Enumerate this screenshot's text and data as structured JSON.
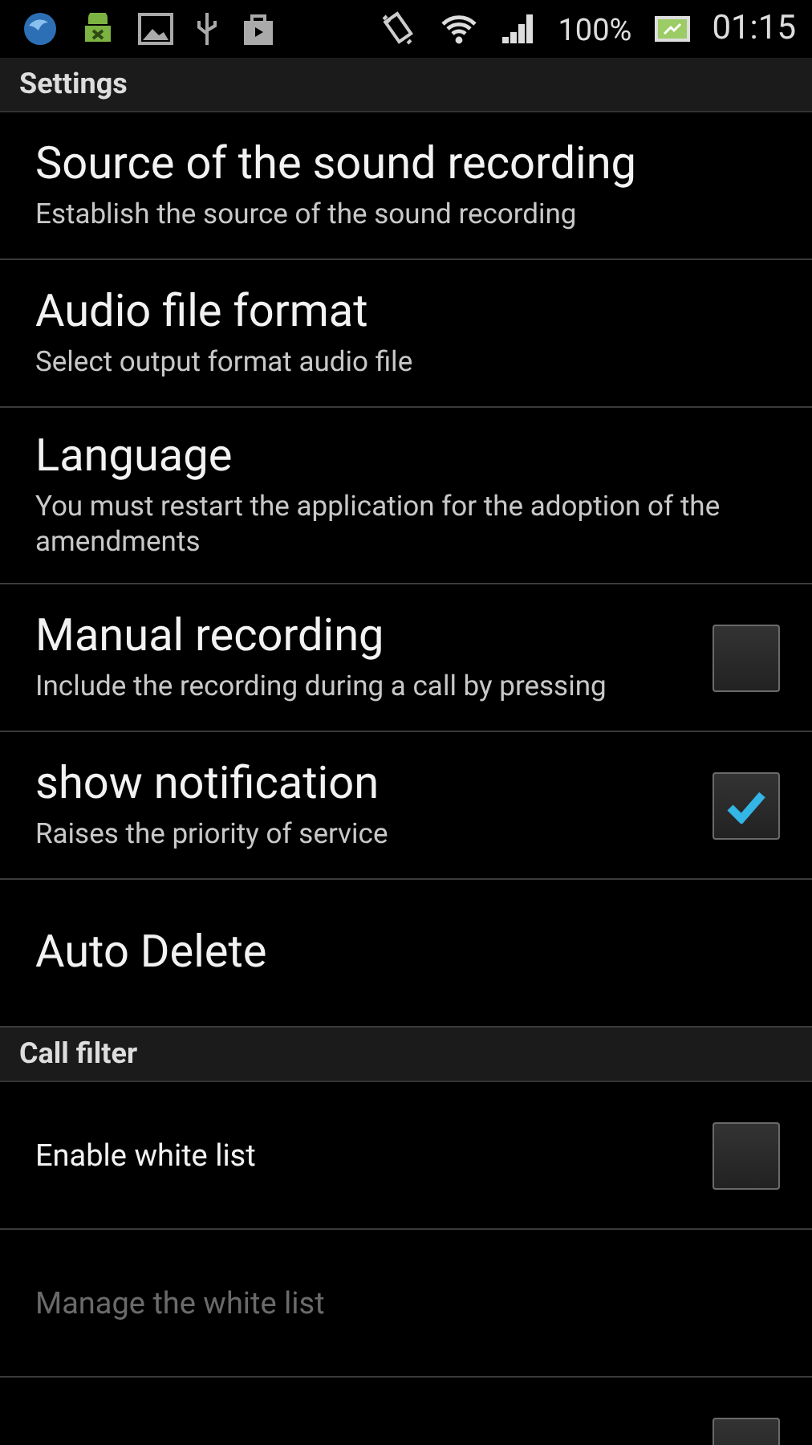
{
  "status_bar": {
    "battery": "100%",
    "time": "01:15"
  },
  "sections": [
    {
      "header": "Settings",
      "items": [
        {
          "kind": "large",
          "title": "Source of the sound recording",
          "summary": "Establish the source of the sound recording",
          "disabled": false
        },
        {
          "kind": "large",
          "title": "Audio file format",
          "summary": "Select output format audio file",
          "disabled": false
        },
        {
          "kind": "large",
          "title": "Language",
          "summary": "You must restart the application for the adoption of the amendments",
          "disabled": false
        },
        {
          "kind": "large",
          "title": "Manual recording",
          "summary": "Include the recording during a call by pressing",
          "checked": false,
          "disabled": false
        },
        {
          "kind": "large",
          "title": "show notification",
          "summary": "Raises the priority of service",
          "checked": true,
          "disabled": false
        },
        {
          "kind": "large",
          "title": "Auto Delete",
          "disabled": false
        }
      ]
    },
    {
      "header": "Call filter",
      "items": [
        {
          "kind": "small",
          "title": "Enable white list",
          "checked": false,
          "disabled": false
        },
        {
          "kind": "small",
          "title": "Manage the white list",
          "disabled": true
        },
        {
          "kind": "small",
          "checked": false,
          "disabled": false
        }
      ]
    }
  ]
}
